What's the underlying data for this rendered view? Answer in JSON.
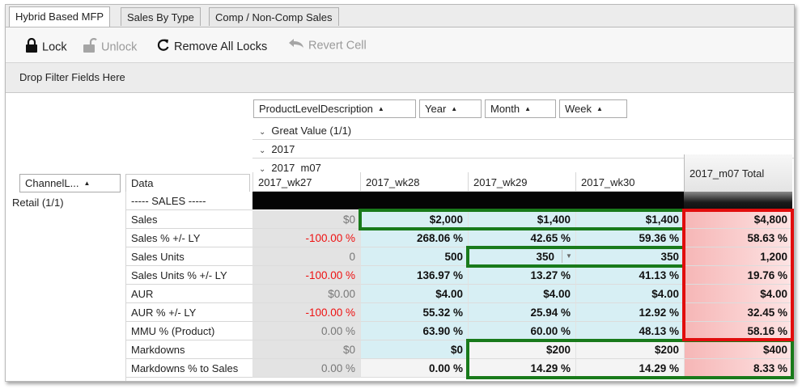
{
  "tabs": [
    {
      "label": "Hybrid Based MFP",
      "active": true
    },
    {
      "label": "Sales By Type",
      "active": false
    },
    {
      "label": "Comp / Non-Comp Sales",
      "active": false
    }
  ],
  "toolbar": {
    "lock": "Lock",
    "unlock": "Unlock",
    "remove_all_locks": "Remove All Locks",
    "revert_cell": "Revert Cell"
  },
  "filter_bar": {
    "placeholder": "Drop Filter Fields Here"
  },
  "pivot": {
    "column_fields": [
      "ProductLevelDescription",
      "Year",
      "Month",
      "Week"
    ],
    "row_field": "ChannelL...",
    "data_field": "Data",
    "groups": [
      "Great Value (1/1)",
      "2017",
      "2017_m07"
    ],
    "columns": [
      "2017_wk27",
      "2017_wk28",
      "2017_wk29",
      "2017_wk30"
    ],
    "total_column": "2017_m07 Total",
    "row_group": "Retail (1/1)",
    "section_label": "----- SALES -----",
    "rows": [
      {
        "label": "Sales",
        "values": [
          "$0",
          "$2,000",
          "$1,400",
          "$1,400"
        ],
        "total": "$4,800"
      },
      {
        "label": "Sales % +/- LY",
        "values": [
          "-100.00 %",
          "268.06 %",
          "42.65 %",
          "59.36 %"
        ],
        "total": "58.63 %"
      },
      {
        "label": "Sales Units",
        "values": [
          "0",
          "500",
          "350",
          "350"
        ],
        "total": "1,200"
      },
      {
        "label": "Sales Units % +/- LY",
        "values": [
          "-100.00 %",
          "136.97 %",
          "13.27 %",
          "41.13 %"
        ],
        "total": "19.76 %"
      },
      {
        "label": "AUR",
        "values": [
          "$0.00",
          "$4.00",
          "$4.00",
          "$4.00"
        ],
        "total": "$4.00"
      },
      {
        "label": "AUR % +/- LY",
        "values": [
          "-100.00 %",
          "55.32 %",
          "25.94 %",
          "12.92 %"
        ],
        "total": "32.45 %"
      },
      {
        "label": "MMU % (Product)",
        "values": [
          "0.00 %",
          "63.90 %",
          "60.00 %",
          "48.13 %"
        ],
        "total": "58.16 %"
      },
      {
        "label": "Markdowns",
        "values": [
          "$0",
          "$0",
          "$200",
          "$200"
        ],
        "total": "$400"
      },
      {
        "label": "Markdowns % to Sales",
        "values": [
          "0.00 %",
          "0.00 %",
          "14.29 %",
          "14.29 %"
        ],
        "total": "8.33 %"
      }
    ]
  },
  "colors": {
    "highlight_green": "#197a1b",
    "highlight_red": "#e10d0d",
    "negative_text": "#e11111",
    "edited_cell_bg": "#d7eff4"
  }
}
